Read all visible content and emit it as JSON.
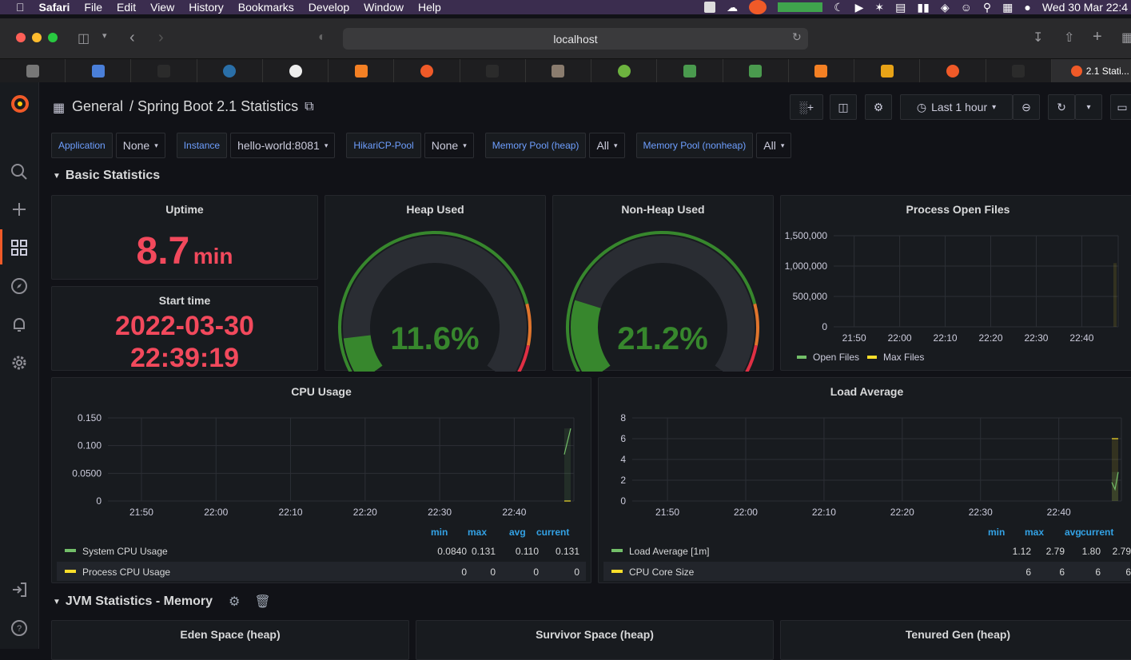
{
  "menubar": {
    "app": "Safari",
    "items": [
      "File",
      "Edit",
      "View",
      "History",
      "Bookmarks",
      "Develop",
      "Window",
      "Help"
    ],
    "clock": "Wed 30 Mar  22:4"
  },
  "browser": {
    "url": "localhost",
    "active_tab_label": "2.1 Stati..."
  },
  "header": {
    "breadcrumb_root": "General",
    "title": "/ Spring Boot 2.1 Statistics",
    "time_range": "Last 1 hour"
  },
  "variables": [
    {
      "label": "Application",
      "value": "None"
    },
    {
      "label": "Instance",
      "value": "hello-world:8081"
    },
    {
      "label": "HikariCP-Pool",
      "value": "None"
    },
    {
      "label": "Memory Pool (heap)",
      "value": "All"
    },
    {
      "label": "Memory Pool (nonheap)",
      "value": "All"
    }
  ],
  "rows": {
    "basic": "Basic Statistics",
    "jvm_memory": "JVM Statistics - Memory"
  },
  "panels": {
    "uptime": {
      "title": "Uptime",
      "value": "8.7",
      "unit": "min"
    },
    "start_time": {
      "title": "Start time",
      "date": "2022-03-30",
      "time": "22:39:19"
    },
    "heap": {
      "title": "Heap Used",
      "value": "11.6%",
      "fraction": 0.116
    },
    "nonheap": {
      "title": "Non-Heap Used",
      "value": "21.2%",
      "fraction": 0.212
    },
    "open_files": {
      "title": "Process Open Files"
    },
    "cpu": {
      "title": "CPU Usage"
    },
    "load": {
      "title": "Load Average"
    },
    "eden": {
      "title": "Eden Space (heap)"
    },
    "survivor": {
      "title": "Survivor Space (heap)"
    },
    "tenured": {
      "title": "Tenured Gen (heap)"
    }
  },
  "legend_headers": {
    "min": "min",
    "max": "max",
    "avg": "avg",
    "current": "current"
  },
  "colors": {
    "green": "#73bf69",
    "yellow": "#fade2a",
    "red": "#f2495c",
    "blue_link": "#6e9fff"
  },
  "chart_data": [
    {
      "type": "line",
      "title": "Process Open Files",
      "x": [
        "21:50",
        "22:00",
        "22:10",
        "22:20",
        "22:30",
        "22:40"
      ],
      "ylim": [
        0,
        1500000
      ],
      "yticks": [
        "1,500,000",
        "1,000,000",
        "500,000",
        "0"
      ],
      "series": [
        {
          "name": "Open Files",
          "color": "#73bf69",
          "values": [
            0
          ]
        },
        {
          "name": "Max Files",
          "color": "#fade2a",
          "values": [
            1048576
          ]
        }
      ],
      "legend": "bottom"
    },
    {
      "type": "line",
      "title": "CPU Usage",
      "x": [
        "21:50",
        "22:00",
        "22:10",
        "22:20",
        "22:30",
        "22:40"
      ],
      "ylim": [
        0,
        0.15
      ],
      "yticks": [
        "0.150",
        "0.100",
        "0.0500",
        "0"
      ],
      "series": [
        {
          "name": "System CPU Usage",
          "color": "#73bf69",
          "min": "0.0840",
          "max": "0.131",
          "avg": "0.110",
          "current": "0.131",
          "values": [
            0.084,
            0.131
          ]
        },
        {
          "name": "Process CPU Usage",
          "color": "#fade2a",
          "min": "0",
          "max": "0",
          "avg": "0",
          "current": "0",
          "values": [
            0,
            0
          ]
        }
      ],
      "legend": "bottom-table"
    },
    {
      "type": "line",
      "title": "Load Average",
      "x": [
        "21:50",
        "22:00",
        "22:10",
        "22:20",
        "22:30",
        "22:40"
      ],
      "ylim": [
        0,
        8
      ],
      "yticks": [
        "8",
        "6",
        "4",
        "2",
        "0"
      ],
      "series": [
        {
          "name": "Load Average [1m]",
          "color": "#73bf69",
          "min": "1.12",
          "max": "2.79",
          "avg": "1.80",
          "current": "2.79",
          "values": [
            1.8,
            1.12,
            2.79
          ]
        },
        {
          "name": "CPU Core Size",
          "color": "#fade2a",
          "min": "6",
          "max": "6",
          "avg": "6",
          "current": "6",
          "values": [
            6,
            6
          ]
        }
      ],
      "legend": "bottom-table"
    }
  ]
}
